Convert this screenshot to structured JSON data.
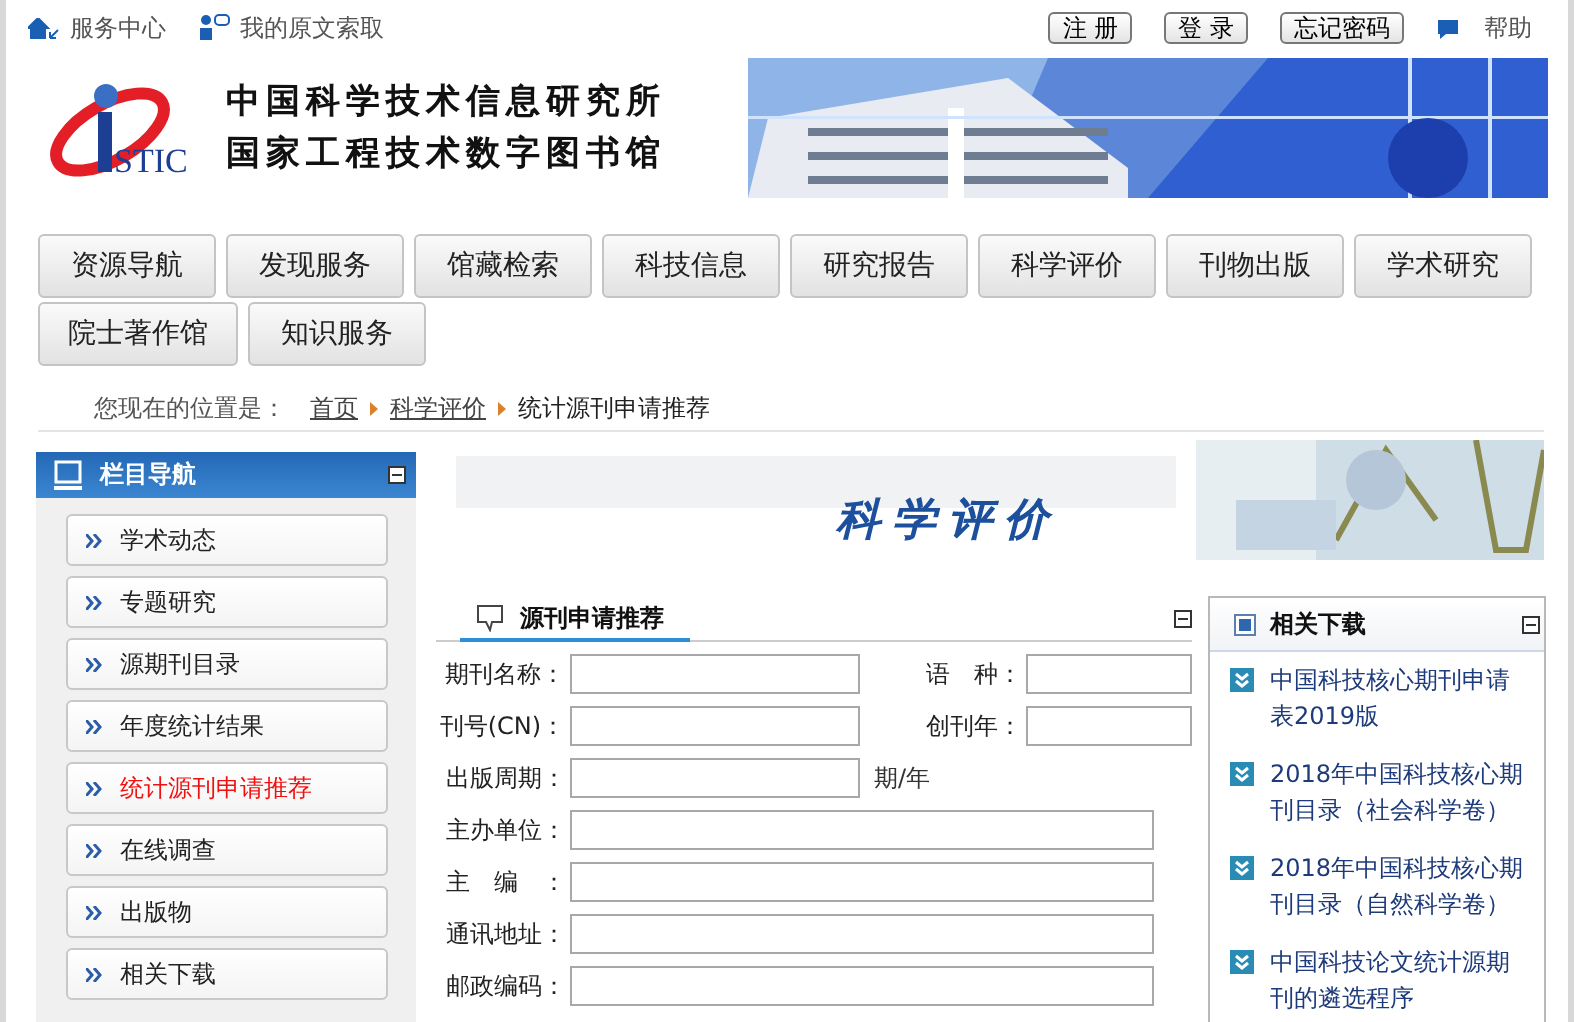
{
  "top_bar": {
    "links": [
      {
        "label": "服务中心",
        "kind": "home"
      },
      {
        "label": "我的原文索取",
        "kind": "user"
      }
    ],
    "buttons": [
      "注 册",
      "登 录",
      "忘记密码"
    ],
    "help": "帮助"
  },
  "header": {
    "logo_text": "STIC",
    "org_lines": [
      "中国科学技术信息研究所",
      "国家工程技术数字图书馆"
    ]
  },
  "nav_tabs": [
    {
      "label": "资源导航",
      "selected": false
    },
    {
      "label": "发现服务",
      "selected": false
    },
    {
      "label": "馆藏检索",
      "selected": false
    },
    {
      "label": "科技信息",
      "selected": false
    },
    {
      "label": "研究报告",
      "selected": false
    },
    {
      "label": "科学评价",
      "selected": false
    },
    {
      "label": "刊物出版",
      "selected": false
    },
    {
      "label": "学术研究",
      "selected": false
    },
    {
      "label": "院士著作馆",
      "selected": false
    },
    {
      "label": "知识服务",
      "selected": false
    }
  ],
  "breadcrumb": {
    "prefix": "您现在的位置是：",
    "items": [
      {
        "label": "首页",
        "kind": "link"
      },
      {
        "label": "科学评价",
        "kind": "link"
      },
      {
        "label": "统计源刊申请推荐",
        "kind": "current"
      }
    ]
  },
  "sidebar": {
    "title": "栏目导航",
    "items": [
      {
        "label": "学术动态",
        "selected": false
      },
      {
        "label": "专题研究",
        "selected": false
      },
      {
        "label": "源期刊目录",
        "selected": false
      },
      {
        "label": "年度统计结果",
        "selected": false
      },
      {
        "label": "统计源刊申请推荐",
        "selected": true
      },
      {
        "label": "在线调查",
        "selected": false
      },
      {
        "label": "出版物",
        "selected": false
      },
      {
        "label": "相关下载",
        "selected": false
      }
    ]
  },
  "banner": {
    "title": "科学评价"
  },
  "form": {
    "title": "源刊申请推荐",
    "rows": [
      {
        "fields": [
          {
            "label": "期刊名称：",
            "kind": "short"
          },
          {
            "label": "语　种：",
            "kind": "small"
          }
        ]
      },
      {
        "fields": [
          {
            "label": "刊号(CN)：",
            "kind": "short"
          },
          {
            "label": "创刊年：",
            "kind": "small"
          }
        ]
      },
      {
        "fields": [
          {
            "label": "出版周期：",
            "kind": "short",
            "suffix": "期/年"
          }
        ]
      },
      {
        "fields": [
          {
            "label": "主办单位：",
            "kind": "long"
          }
        ]
      },
      {
        "fields": [
          {
            "label": "主　编　：",
            "kind": "long"
          }
        ]
      },
      {
        "fields": [
          {
            "label": "通讯地址：",
            "kind": "long"
          }
        ]
      },
      {
        "fields": [
          {
            "label": "邮政编码：",
            "kind": "long"
          }
        ]
      }
    ]
  },
  "downloads": {
    "title": "相关下载",
    "items": [
      "中国科技核心期刊申请表2019版",
      "2018年中国科技核心期刊目录（社会科学卷）",
      "2018年中国科技核心期刊目录（自然科学卷）",
      "中国科技论文统计源期刊的遴选程序"
    ]
  }
}
